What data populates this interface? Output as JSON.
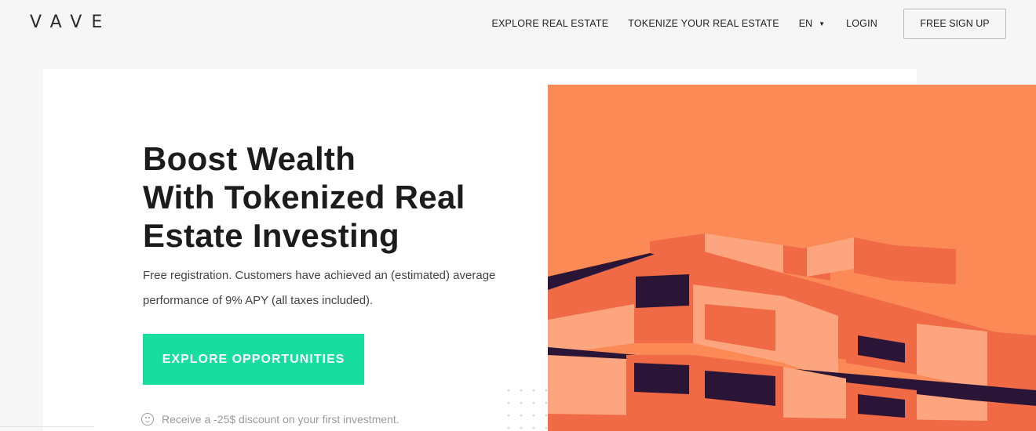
{
  "header": {
    "logo": "VAVE",
    "nav": {
      "explore": "EXPLORE REAL ESTATE",
      "tokenize": "TOKENIZE YOUR REAL ESTATE",
      "language": "EN",
      "login": "LOGIN",
      "signup": "FREE SIGN UP"
    },
    "icons": {
      "language_caret": "caret-down-icon"
    }
  },
  "hero": {
    "title_lines": [
      "Boost Wealth",
      "With Tokenized Real",
      "Estate Investing"
    ],
    "subtitle_lines": [
      "Free registration. Customers have achieved an (estimated) average",
      "performance of 9% APY (all taxes included)."
    ],
    "cta": "EXPLORE OPPORTUNITIES",
    "discount": "Receive a -25$ discount on your first investment.",
    "discount_icon": "smile-icon"
  },
  "colors": {
    "accent": "#17de9f",
    "art_background": "#fb8a57",
    "building_main": "#ef6a45",
    "building_light": "#fca57f",
    "building_dark": "#2a1536"
  }
}
